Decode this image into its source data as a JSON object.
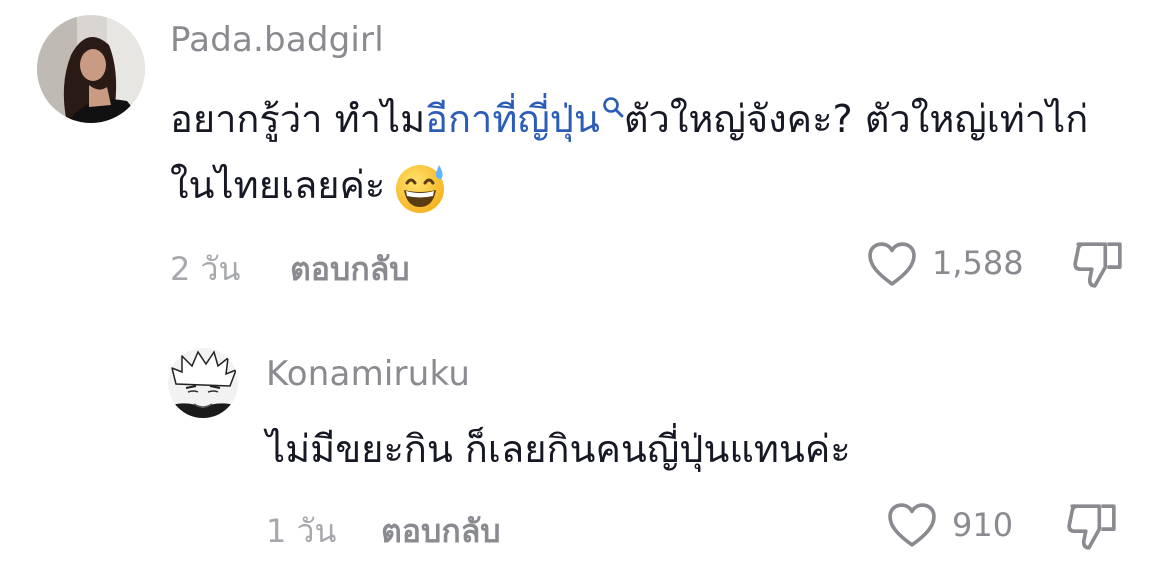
{
  "comments": [
    {
      "username": "Pada.badgirl",
      "text_before": "อยากรู้ว่า ทำไม",
      "link_text": "อีกาที่ญี่ปุ่น",
      "text_after": "ตัวใหญ่จังคะ? ตัวใหญ่เท่าไก่ในไทยเลยค่ะ",
      "emoji_name": "grinning-sweat-emoji",
      "time": "2 วัน",
      "reply_label": "ตอบกลับ",
      "likes": "1,588"
    },
    {
      "username": "Konamiruku",
      "text": "ไม่มีขยะกิน ก็เลยกินคนญี่ปุ่นแทนค่ะ",
      "time": "1 วัน",
      "reply_label": "ตอบกลับ",
      "likes": "910"
    }
  ],
  "icons": {
    "like": "heart-icon",
    "dislike": "thumbs-down-icon",
    "search": "magnifier-icon"
  },
  "colors": {
    "link": "#2b5db8",
    "muted": "#8a8b91",
    "text": "#161823"
  }
}
